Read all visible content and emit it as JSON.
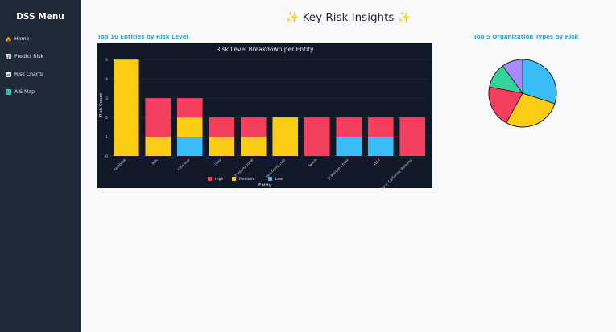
{
  "sidebar": {
    "title": "DSS Menu",
    "items": [
      {
        "label": "Home",
        "icon": "house-icon"
      },
      {
        "label": "Predict Risk",
        "icon": "bar-chart-icon"
      },
      {
        "label": "Risk Charts",
        "icon": "line-chart-icon"
      },
      {
        "label": "AIS Map",
        "icon": "map-icon"
      }
    ]
  },
  "header": {
    "title": "Key Risk Insights",
    "sparkle": "✨"
  },
  "sections": {
    "left_label": "Top 10 Entities by Risk Level",
    "right_label": "Top 5 Organization Types by Risk"
  },
  "colors": {
    "high": "#f43f5e",
    "medium": "#facc15",
    "low": "#38bdf8",
    "sidebar_bg": "#1f2937",
    "chart_bg": "#111827",
    "section_label": "#2fa6c9"
  },
  "chart_data": [
    {
      "type": "bar",
      "stacked": true,
      "title": "Risk Level Breakdown per Entity",
      "xlabel": "Entity",
      "ylabel": "Risk Count",
      "ylim": [
        0,
        5.3
      ],
      "yticks": [
        0,
        1,
        2,
        3,
        4,
        5
      ],
      "categories": [
        "Facebook",
        "AOL",
        "Citigroup",
        "Uber",
        "T International",
        "Heartland Corp",
        "Twitch",
        "JP Morgan Chase",
        "AT&T",
        "University of California, Berkeley"
      ],
      "series": [
        {
          "name": "Low",
          "color": "#38bdf8",
          "values": [
            0,
            0,
            1,
            0,
            0,
            0,
            0,
            1,
            1,
            0
          ]
        },
        {
          "name": "Medium",
          "color": "#facc15",
          "values": [
            5,
            1,
            1,
            1,
            1,
            2,
            0,
            0,
            0,
            0
          ]
        },
        {
          "name": "High",
          "color": "#f43f5e",
          "values": [
            0,
            2,
            1,
            1,
            1,
            0,
            2,
            1,
            1,
            2
          ]
        }
      ],
      "legend": [
        "High",
        "Medium",
        "Low"
      ],
      "legend_position": "bottom"
    },
    {
      "type": "pie",
      "title": "",
      "slices": [
        {
          "value": 30,
          "color": "#38bdf8"
        },
        {
          "value": 28,
          "color": "#facc15"
        },
        {
          "value": 20,
          "color": "#f43f5e"
        },
        {
          "value": 12,
          "color": "#34d399"
        },
        {
          "value": 10,
          "color": "#a78bfa"
        }
      ]
    }
  ]
}
